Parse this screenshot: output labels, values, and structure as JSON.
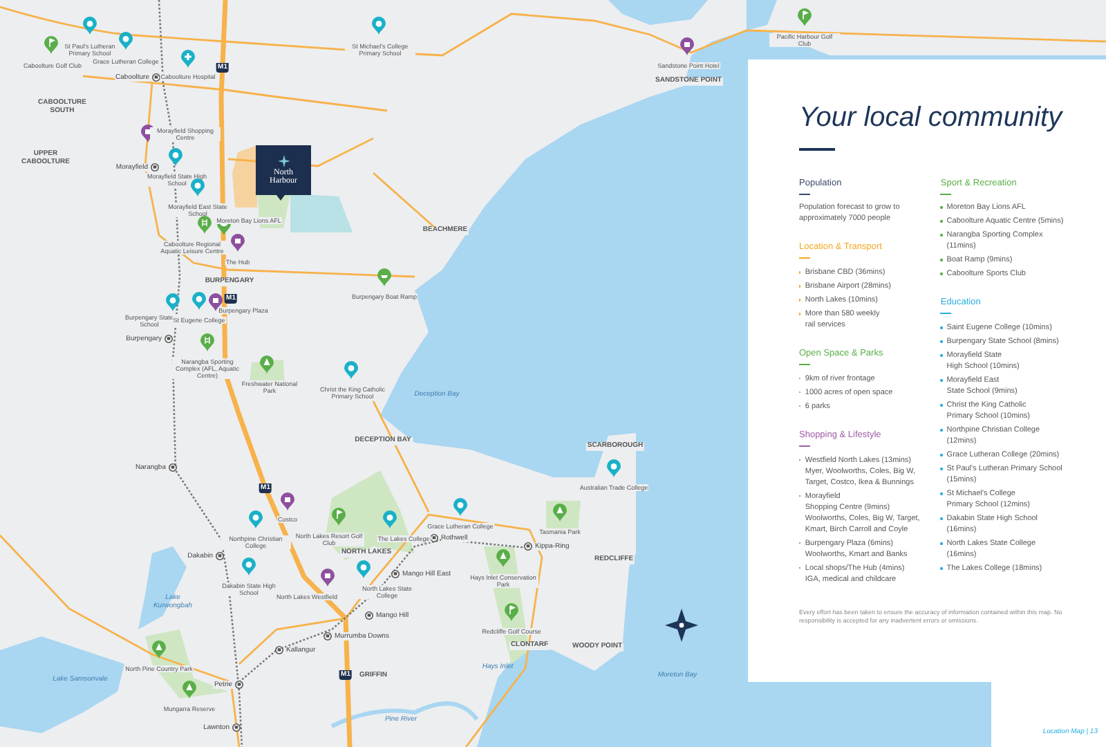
{
  "map": {
    "property": {
      "name": "North Harbour"
    },
    "shields": [
      {
        "text": "M1"
      },
      {
        "text": "M1"
      },
      {
        "text": "M1"
      },
      {
        "text": "M1"
      }
    ],
    "places": [
      {
        "kind": "suburb",
        "text": "CABOOLTURE SOUTH"
      },
      {
        "kind": "suburb",
        "text": "UPPER CABOOLTURE"
      },
      {
        "kind": "suburb",
        "text": "BURPENGARY"
      },
      {
        "kind": "suburb",
        "text": "BEACHMERE"
      },
      {
        "kind": "suburb",
        "text": "SANDSTONE POINT"
      },
      {
        "kind": "suburb",
        "text": "DECEPTION BAY"
      },
      {
        "kind": "suburb",
        "text": "NORTH LAKES"
      },
      {
        "kind": "suburb",
        "text": "GRIFFIN"
      },
      {
        "kind": "suburb",
        "text": "SCARBOROUGH"
      },
      {
        "kind": "suburb",
        "text": "REDCLIFFE"
      },
      {
        "kind": "suburb",
        "text": "CLONTARF"
      },
      {
        "kind": "suburb",
        "text": "WOODY POINT"
      },
      {
        "kind": "water",
        "text": "Deception Bay"
      },
      {
        "kind": "water",
        "text": "Lake Kurwongbah"
      },
      {
        "kind": "water",
        "text": "Lake Samsonvale"
      },
      {
        "kind": "water",
        "text": "Hays Inlet"
      },
      {
        "kind": "water",
        "text": "Pine River"
      },
      {
        "kind": "water",
        "text": "Moreton Bay"
      }
    ],
    "stations": [
      {
        "name": "Caboolture"
      },
      {
        "name": "Morayfield"
      },
      {
        "name": "Burpengary"
      },
      {
        "name": "Narangba"
      },
      {
        "name": "Dakabin"
      },
      {
        "name": "Petrie"
      },
      {
        "name": "Lawnton"
      },
      {
        "name": "Kallangur"
      },
      {
        "name": "Murrumba Downs"
      },
      {
        "name": "Mango Hill"
      },
      {
        "name": "Mango Hill East"
      },
      {
        "name": "Rothwell"
      },
      {
        "name": "Kippa-Ring"
      }
    ],
    "pins": [
      {
        "kind": "school",
        "color": "#1ab0c8",
        "label": "St Paul's Lutheran Primary School"
      },
      {
        "kind": "golf",
        "color": "#5aae49",
        "label": "Caboolture Golf Club"
      },
      {
        "kind": "school",
        "color": "#1ab0c8",
        "label": "Grace Lutheran College"
      },
      {
        "kind": "hospital",
        "color": "#1ab0c8",
        "label": "Caboolture Hospital"
      },
      {
        "kind": "school",
        "color": "#1ab0c8",
        "label": "St Michael's College Primary School"
      },
      {
        "kind": "shop",
        "color": "#8e4f9e",
        "label": "Sandstone Point Hotel"
      },
      {
        "kind": "golf",
        "color": "#5aae49",
        "label": "Pacific Harbour Golf Club"
      },
      {
        "kind": "shop",
        "color": "#8e4f9e",
        "label": "Morayfield Shopping Centre"
      },
      {
        "kind": "school",
        "color": "#1ab0c8",
        "label": "Morayfield State High School"
      },
      {
        "kind": "school",
        "color": "#1ab0c8",
        "label": "Morayfield East State School"
      },
      {
        "kind": "pool",
        "color": "#5aae49",
        "label": "Caboolture Regional Aquatic Leisure Centre"
      },
      {
        "kind": "sport",
        "color": "#5aae49",
        "label": "Moreton Bay Lions AFL"
      },
      {
        "kind": "shop",
        "color": "#8e4f9e",
        "label": "The Hub"
      },
      {
        "kind": "boat",
        "color": "#5aae49",
        "label": "Burpengary Boat Ramp"
      },
      {
        "kind": "school",
        "color": "#1ab0c8",
        "label": "Burpengary State School"
      },
      {
        "kind": "school",
        "color": "#1ab0c8",
        "label": "St Eugene College"
      },
      {
        "kind": "shop",
        "color": "#8e4f9e",
        "label": "Burpengary Plaza"
      },
      {
        "kind": "pool",
        "color": "#5aae49",
        "label": "Narangba Sporting Complex (AFL, Aquatic Centre)"
      },
      {
        "kind": "tree",
        "color": "#5aae49",
        "label": "Freshwater National Park"
      },
      {
        "kind": "school",
        "color": "#1ab0c8",
        "label": "Christ the King Catholic Primary School"
      },
      {
        "kind": "shop",
        "color": "#8e4f9e",
        "label": "Costco"
      },
      {
        "kind": "school",
        "color": "#1ab0c8",
        "label": "Northpine Christian College"
      },
      {
        "kind": "golf",
        "color": "#5aae49",
        "label": "North Lakes Resort Golf Club"
      },
      {
        "kind": "school",
        "color": "#1ab0c8",
        "label": "Dakabin State High School"
      },
      {
        "kind": "shop",
        "color": "#8e4f9e",
        "label": "North Lakes Westfield"
      },
      {
        "kind": "school",
        "color": "#1ab0c8",
        "label": "North Lakes State College"
      },
      {
        "kind": "school",
        "color": "#1ab0c8",
        "label": "The Lakes College"
      },
      {
        "kind": "school",
        "color": "#1ab0c8",
        "label": "Grace Lutheran College"
      },
      {
        "kind": "tree",
        "color": "#5aae49",
        "label": "North Pine Country Park"
      },
      {
        "kind": "tree",
        "color": "#5aae49",
        "label": "Mungarra Reserve"
      },
      {
        "kind": "tree",
        "color": "#5aae49",
        "label": "Hays Inlet Conservation Park"
      },
      {
        "kind": "golf",
        "color": "#5aae49",
        "label": "Redcliffe Golf Course"
      },
      {
        "kind": "tree",
        "color": "#5aae49",
        "label": "Tasmania Park"
      },
      {
        "kind": "school",
        "color": "#1ab0c8",
        "label": "Australian Trade College"
      }
    ]
  },
  "panel": {
    "title": "Your local community",
    "columns": [
      [
        {
          "heading": "Population",
          "color": "#3a4a6b",
          "text": "Population forecast to grow to approximately 7000 people"
        },
        {
          "heading": "Location & Transport",
          "color": "#f5a623",
          "items": [
            [
              "Brisbane CBD  (36mins)"
            ],
            [
              "Brisbane Airport  (28mins)"
            ],
            [
              "North Lakes  (10mins)"
            ],
            [
              "More than 580 weekly",
              "rail services"
            ]
          ]
        },
        {
          "heading": "Open Space & Parks",
          "color": "#5aae49",
          "items": [
            [
              "9km of river frontage"
            ],
            [
              "1000 acres of open space"
            ],
            [
              "6 parks"
            ]
          ]
        },
        {
          "heading": "Shopping & Lifestyle",
          "color": "#a05ca8",
          "items": [
            [
              "Westfield North Lakes  (13mins)",
              "Myer, Woolworths, Coles, Big W,",
              "Target, Costco, Ikea & Bunnings"
            ],
            [
              "Morayfield",
              "Shopping Centre  (9mins)",
              "Woolworths, Coles, Big W, Target,",
              "Kmart, Birch Carroll and Coyle"
            ],
            [
              "Burpengary Plaza  (6mins)",
              "Woolworths, Kmart and Banks"
            ],
            [
              "Local shops/The Hub  (4mins)",
              "IGA, medical and childcare"
            ]
          ]
        }
      ],
      [
        {
          "heading": "Sport & Recreation",
          "color": "#5aae49",
          "items": [
            [
              "Moreton Bay Lions AFL"
            ],
            [
              "Caboolture Aquatic Centre  (5mins)"
            ],
            [
              "Narangba Sporting Complex",
              "(11mins)"
            ],
            [
              "Boat Ramp  (9mins)"
            ],
            [
              "Caboolture Sports Club"
            ]
          ]
        },
        {
          "heading": "Education",
          "color": "#29aee0",
          "items": [
            [
              "Saint Eugene College  (10mins)"
            ],
            [
              "Burpengary State School  (8mins)"
            ],
            [
              "Morayfield State",
              "High School  (10mins)"
            ],
            [
              "Morayfield East",
              "State School  (9mins)"
            ],
            [
              "Christ the King Catholic",
              "Primary School  (10mins)"
            ],
            [
              "Northpine Christian College",
              "(12mins)"
            ],
            [
              "Grace Lutheran College  (20mins)"
            ],
            [
              "St Paul's Lutheran Primary School",
              "(15mins)"
            ],
            [
              "St Michael's College",
              "Primary School (12mins)"
            ],
            [
              "Dakabin State High School",
              "(16mins)"
            ],
            [
              "North Lakes State College",
              "(16mins)"
            ],
            [
              "The Lakes College  (18mins)"
            ]
          ]
        }
      ]
    ],
    "disclaimer": "Every effort has been taken to ensure the accuracy of information contained within this map. No responsibility is accepted for any inadvertent errors or omissions."
  },
  "footer": "Location Map | 13"
}
